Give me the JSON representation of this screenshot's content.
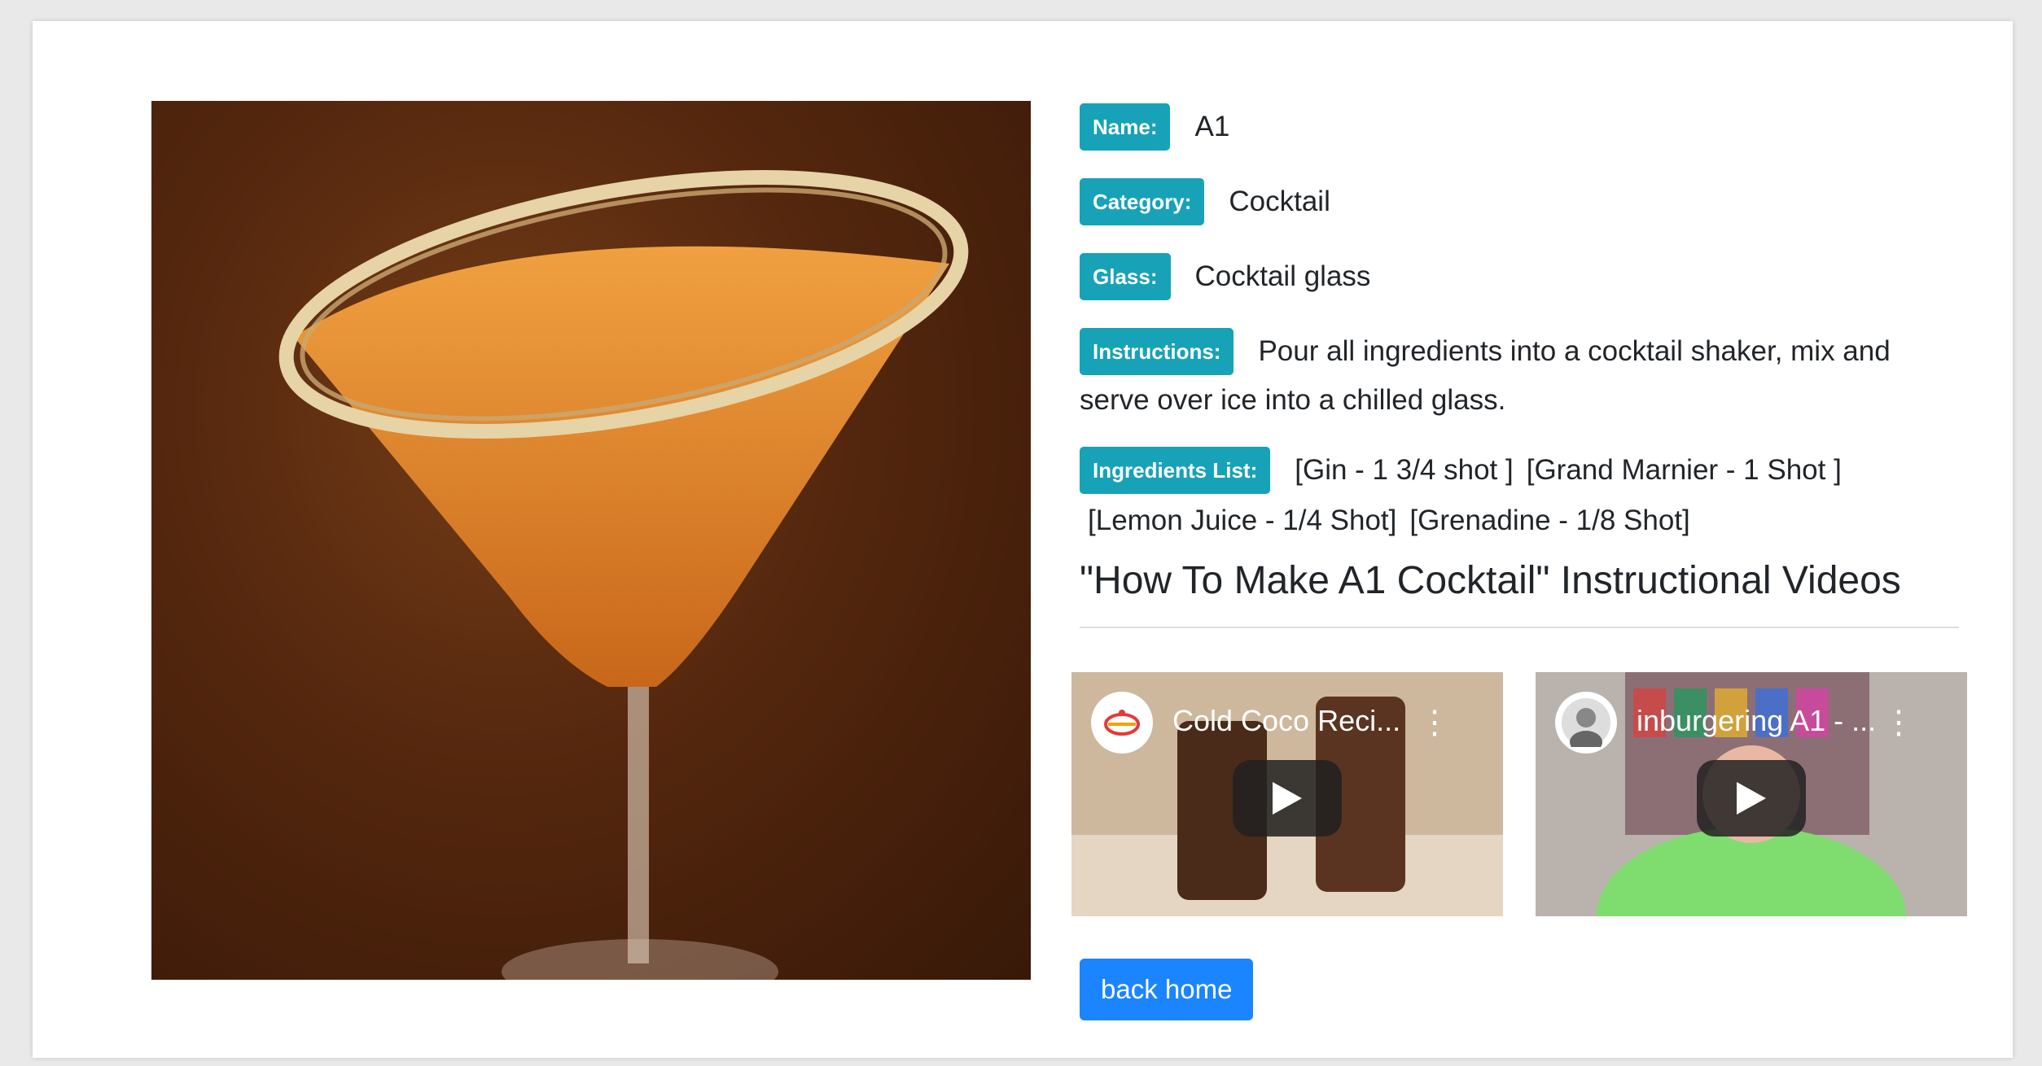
{
  "drink": {
    "name_label": "Name:",
    "name": "A1",
    "category_label": "Category:",
    "category": "Cocktail",
    "glass_label": "Glass:",
    "glass": "Cocktail glass",
    "instructions_label": "Instructions:",
    "instructions_line1": "Pour all ingredients into a cocktail shaker, mix and",
    "instructions_line2": "serve over ice into a chilled glass.",
    "ingredients_label": "Ingredients List:",
    "ingredients": [
      "[Gin - 1 3/4 shot ]",
      "[Grand Marnier - 1 Shot ]",
      "[Lemon Juice - 1/4 Shot]",
      "[Grenadine - 1/8 Shot]"
    ]
  },
  "videos": {
    "heading": "\"How To Make A1 Cocktail\" Instructional Videos",
    "items": [
      {
        "title": "Cold Coco Reci...",
        "icon": "chef-pot-icon"
      },
      {
        "title": "inburgering A1 - ...",
        "icon": "avatar-photo"
      }
    ]
  },
  "actions": {
    "back_home": "back home"
  },
  "colors": {
    "badge": "#17a2b8",
    "button": "#1a85ff"
  }
}
